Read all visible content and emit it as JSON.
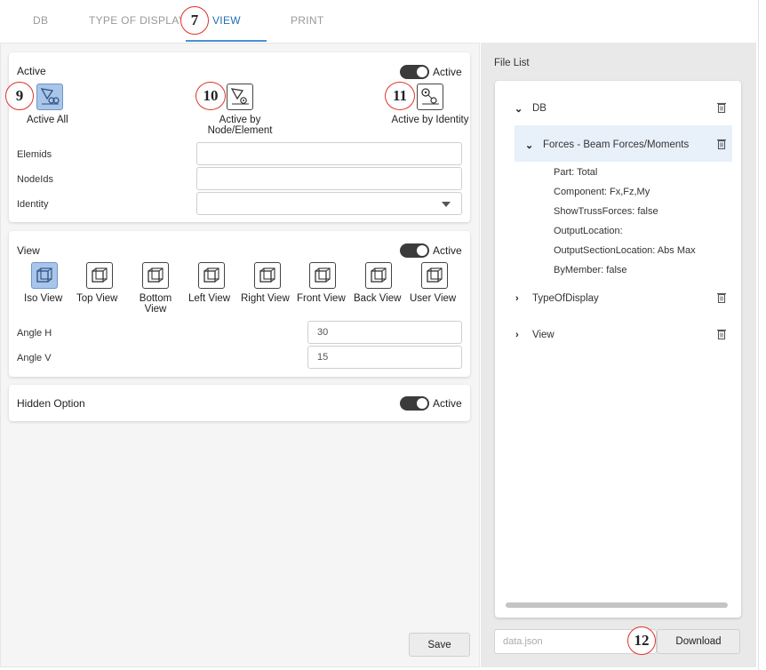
{
  "tabs": [
    {
      "label": "DB"
    },
    {
      "label": "TYPE OF DISPLAY"
    },
    {
      "label": "VIEW",
      "active": true
    },
    {
      "label": "PRINT"
    }
  ],
  "callouts": {
    "tab": "7",
    "active_all": "9",
    "active_node": "10",
    "active_identity": "11",
    "download": "12"
  },
  "active_section": {
    "title": "Active",
    "toggle_label": "Active",
    "toggle_on": true,
    "buttons": [
      {
        "label": "Active All",
        "icon": "active-all-icon",
        "selected": true
      },
      {
        "label": "Active by Node/Element",
        "icon": "active-by-node-element-icon",
        "selected": false
      },
      {
        "label": "Active by Identity",
        "icon": "active-by-identity-icon",
        "selected": false
      }
    ],
    "fields": [
      {
        "label": "Elemids",
        "value": ""
      },
      {
        "label": "NodeIds",
        "value": ""
      },
      {
        "label": "Identity",
        "value": ""
      }
    ]
  },
  "view_section": {
    "title": "View",
    "toggle_label": "Active",
    "toggle_on": true,
    "views": [
      {
        "label": "Iso View",
        "selected": true
      },
      {
        "label": "Top View"
      },
      {
        "label": "Bottom View"
      },
      {
        "label": "Left View"
      },
      {
        "label": "Right View"
      },
      {
        "label": "Front View"
      },
      {
        "label": "Back View"
      },
      {
        "label": "User View"
      }
    ],
    "angle_h": {
      "label": "Angle H",
      "value": "30"
    },
    "angle_v": {
      "label": "Angle V",
      "value": "15"
    }
  },
  "hidden_section": {
    "title": "Hidden Option",
    "toggle_label": "Active",
    "toggle_on": true
  },
  "save_label": "Save",
  "file_list": {
    "title": "File List",
    "tree": {
      "db": "DB",
      "forces": "Forces - Beam Forces/Moments",
      "props": [
        "Part: Total",
        "Component: Fx,Fz,My",
        "ShowTrussForces: false",
        "OutputLocation:",
        "OutputSectionLocation: Abs Max",
        "ByMember: false"
      ],
      "type_of_display": "TypeOfDisplay",
      "view": "View"
    }
  },
  "filename": {
    "placeholder": "data.json"
  },
  "download_label": "Download",
  "colors": {
    "accent": "#1f6fb8",
    "selected_icon": "#a9c6ea",
    "callout": "#e0302a"
  }
}
